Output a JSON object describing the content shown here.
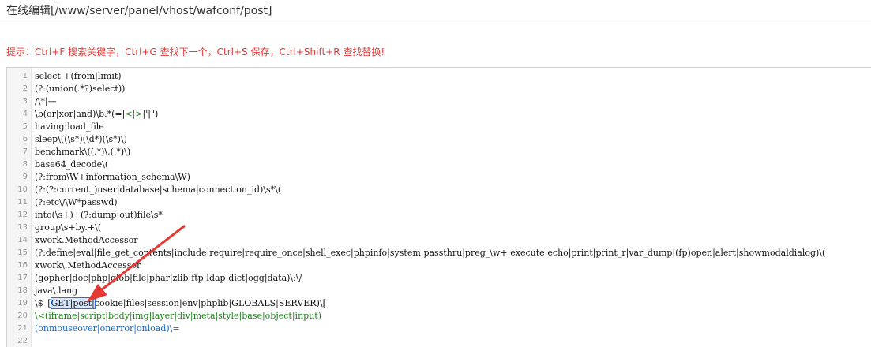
{
  "window": {
    "title": "在线编辑[/www/server/panel/vhost/wafconf/post]"
  },
  "tip": {
    "text": "提示：Ctrl+F 搜索关键字，Ctrl+G 查找下一个，Ctrl+S 保存，Ctrl+Shift+R 查找替换!"
  },
  "editor": {
    "line_numbers": [
      "1",
      "2",
      "3",
      "4",
      "5",
      "6",
      "7",
      "8",
      "9",
      "10",
      "11",
      "12",
      "13",
      "14",
      "15",
      "16",
      "17",
      "18",
      "19",
      "20",
      "21",
      "22"
    ],
    "lines": [
      "select.+(from|limit)",
      "(?:(union(.*?)select))",
      "/\\*|—",
      "\\b(or|xor|and)\\b.*(=|",
      "having|load_file",
      "sleep\\((\\s*)(\\d*)(\\s*)\\)",
      "benchmark\\((.*)\\,(.*)\\)",
      "base64_decode\\(",
      "(?:from\\W+information_schema\\W)",
      "(?:(?:current_)user|database|schema|connection_id)\\s*\\(",
      "(?:etc\\/\\W*passwd)",
      "into(\\s+)+(?:dump|out)file\\s*",
      "group\\s+by.+\\(",
      "xwork.MethodAccessor",
      "(?:define|eval|file_get_contents|include|require|require_once|shell_exec|phpinfo|system|passthru|preg_\\w+|execute|echo|print|print_r|var_dump|(fp)open|alert|showmodaldialog)\\(",
      "xwork\\.MethodAccessor",
      "(gopher|doc|php|glob|file|phar|zlib|ftp|ldap|dict|ogg|data)\\:\\/",
      "java\\.lang",
      "\\$_",
      "\\<(iframe|script|body|img|layer|div|meta|style|base|object|input)",
      "(onmouseover|onerror|onload)\\=",
      ""
    ],
    "line4_green": "<|>",
    "line4_tail": "|'|\")",
    "line19_bracket": "[",
    "line19_highlight": "GET|post|",
    "line19_tail": "cookie|files|session|env|phplib|GLOBALS|SERVER)\\["
  },
  "colors": {
    "tip_text": "#e53935",
    "keyword_green": "#1a7f1a",
    "keyword_blue": "#1565c0",
    "arrow": "#e53935",
    "highlight_border": "#2b6cd6"
  }
}
